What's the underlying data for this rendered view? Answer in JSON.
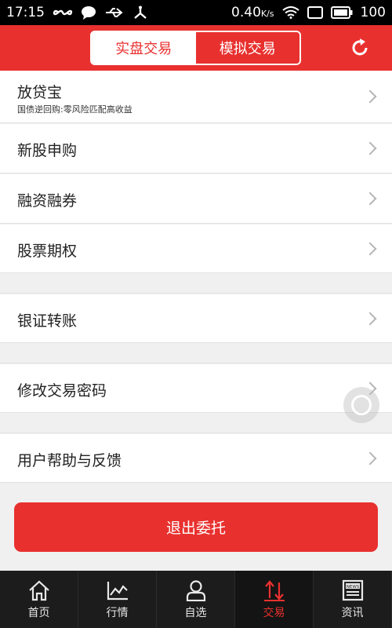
{
  "status_bar": {
    "time": "17:15",
    "data_speed": "0.40",
    "data_unit": "K/s",
    "battery": "100",
    "icons": [
      "infinity-icon",
      "chat-bubble-icon",
      "usb-icon",
      "share-icon",
      "wifi-icon",
      "sim-icon",
      "battery-icon"
    ]
  },
  "header": {
    "tabs": [
      {
        "label": "实盘交易",
        "active": true
      },
      {
        "label": "模拟交易",
        "active": false
      }
    ],
    "refresh_icon": "refresh-icon"
  },
  "menu": {
    "items": [
      {
        "title": "放贷宝",
        "subtitle": "国债逆回购:零风险匹配高收益"
      },
      {
        "title": "新股申购"
      },
      {
        "title": "融资融券"
      },
      {
        "title": "股票期权"
      },
      {
        "title": "银证转账"
      },
      {
        "title": "修改交易密码"
      },
      {
        "title": "用户帮助与反馈"
      }
    ]
  },
  "logout_label": "退出委托",
  "tabbar": {
    "items": [
      {
        "label": "首页",
        "icon": "home-icon",
        "active": false
      },
      {
        "label": "行情",
        "icon": "chart-icon",
        "active": false
      },
      {
        "label": "自选",
        "icon": "user-icon",
        "active": false
      },
      {
        "label": "交易",
        "icon": "trade-arrows-icon",
        "active": true
      },
      {
        "label": "资讯",
        "icon": "news-icon",
        "active": false
      }
    ],
    "news_badge": "NEWS"
  },
  "colors": {
    "brand": "#e8312f",
    "tabbar": "#1c1c1c",
    "background": "#f0f0f0"
  }
}
